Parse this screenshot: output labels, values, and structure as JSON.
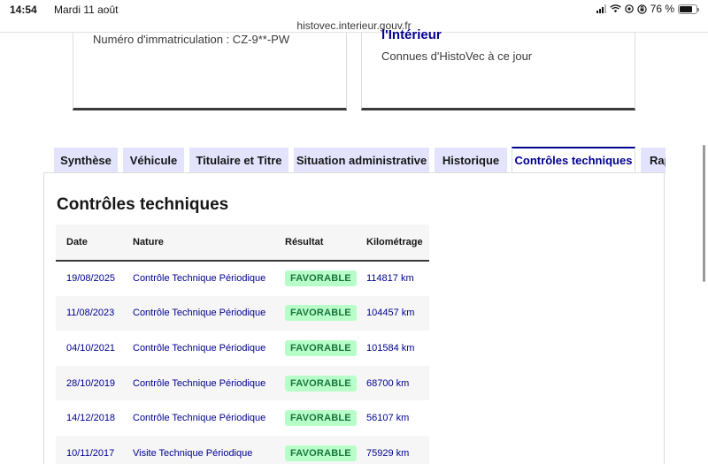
{
  "status": {
    "time": "14:54",
    "date": "Mardi 11 août",
    "battery": "76 %",
    "battery_level": 0.76
  },
  "browser": {
    "url": "histovec.interieur.gouv.fr"
  },
  "cards": {
    "plate_text": "Numéro d'immatriculation : CZ-9**-PW",
    "right_heading": "l'Intérieur",
    "right_sub": "Connues d'HistoVec à ce jour"
  },
  "tabs": [
    {
      "label": "Synthèse"
    },
    {
      "label": "Véhicule"
    },
    {
      "label": "Titulaire et Titre"
    },
    {
      "label": "Situation administrative"
    },
    {
      "label": "Historique"
    },
    {
      "label": "Contrôles techniques",
      "active": true
    },
    {
      "label": "Rap"
    }
  ],
  "section_title": "Contrôles techniques",
  "table": {
    "headers": [
      "Date",
      "Nature",
      "Résultat",
      "Kilométrage"
    ],
    "rows": [
      {
        "date": "19/08/2025",
        "nature": "Contrôle Technique Périodique",
        "result": "FAVORABLE",
        "km": "114817 km"
      },
      {
        "date": "11/08/2023",
        "nature": "Contrôle Technique Périodique",
        "result": "FAVORABLE",
        "km": "104457 km"
      },
      {
        "date": "04/10/2021",
        "nature": "Contrôle Technique Périodique",
        "result": "FAVORABLE",
        "km": "101584 km"
      },
      {
        "date": "28/10/2019",
        "nature": "Contrôle Technique Périodique",
        "result": "FAVORABLE",
        "km": "68700 km"
      },
      {
        "date": "14/12/2018",
        "nature": "Contrôle Technique Périodique",
        "result": "FAVORABLE",
        "km": "56107 km"
      },
      {
        "date": "10/11/2017",
        "nature": "Visite Technique Périodique",
        "result": "FAVORABLE",
        "km": "75929 km"
      }
    ]
  },
  "colors": {
    "primary": "#000091",
    "tab_bg": "#e3e3fd",
    "badge_bg": "#b8fec9",
    "badge_text": "#18753c"
  }
}
